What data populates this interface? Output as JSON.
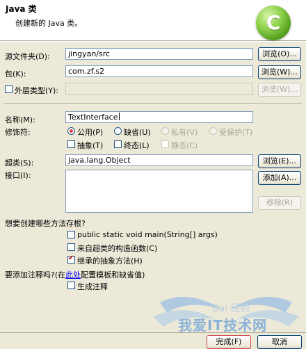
{
  "header": {
    "title": "Java 类",
    "description": "创建新的 Java 类。"
  },
  "source_folder": {
    "label": "源文件夹(D):",
    "value": "jingyan/src",
    "browse": "浏览(O)..."
  },
  "package": {
    "label": "包(K):",
    "value": "com.zf.s2",
    "browse": "浏览(W)..."
  },
  "enclosing_type": {
    "label": "外层类型(Y):",
    "value": "",
    "browse": "浏览(W)...",
    "checked": false
  },
  "name": {
    "label": "名称(M):",
    "value": "TextInterface"
  },
  "modifiers": {
    "label": "修饰符:",
    "public": "公用(P)",
    "default": "缺省(U)",
    "private": "私有(V)",
    "protected": "受保护(T)",
    "abstract": "抽象(T)",
    "final": "终态(L)",
    "static": "静态(C)"
  },
  "superclass": {
    "label": "超类(S):",
    "value": "java.lang.Object",
    "browse": "浏览(E)..."
  },
  "interfaces": {
    "label": "接口(I):",
    "add": "添加(A)...",
    "remove": "移除(R)"
  },
  "stubs": {
    "question": "想要创建哪些方法存根?",
    "main": "public static void main(String[] args)",
    "constructors": "来自超类的构造函数(C)",
    "inherited": "继承的抽象方法(H)"
  },
  "comments": {
    "question_prefix": "要添加注释吗?(在",
    "link": "此处",
    "question_suffix": "配置模板和缺省值)",
    "generate": "生成注释"
  },
  "footer": {
    "finish": "完成(F)",
    "cancel": "取消"
  },
  "watermark": {
    "main": "我爱IT技术网",
    "overlay": "Bai 经验"
  },
  "colors": {
    "accent_red": "#e04040",
    "link_blue": "#0000ff",
    "logo_green": "#6cbf2a"
  },
  "icons": {
    "logo": "eclipse-new-class-logo"
  }
}
